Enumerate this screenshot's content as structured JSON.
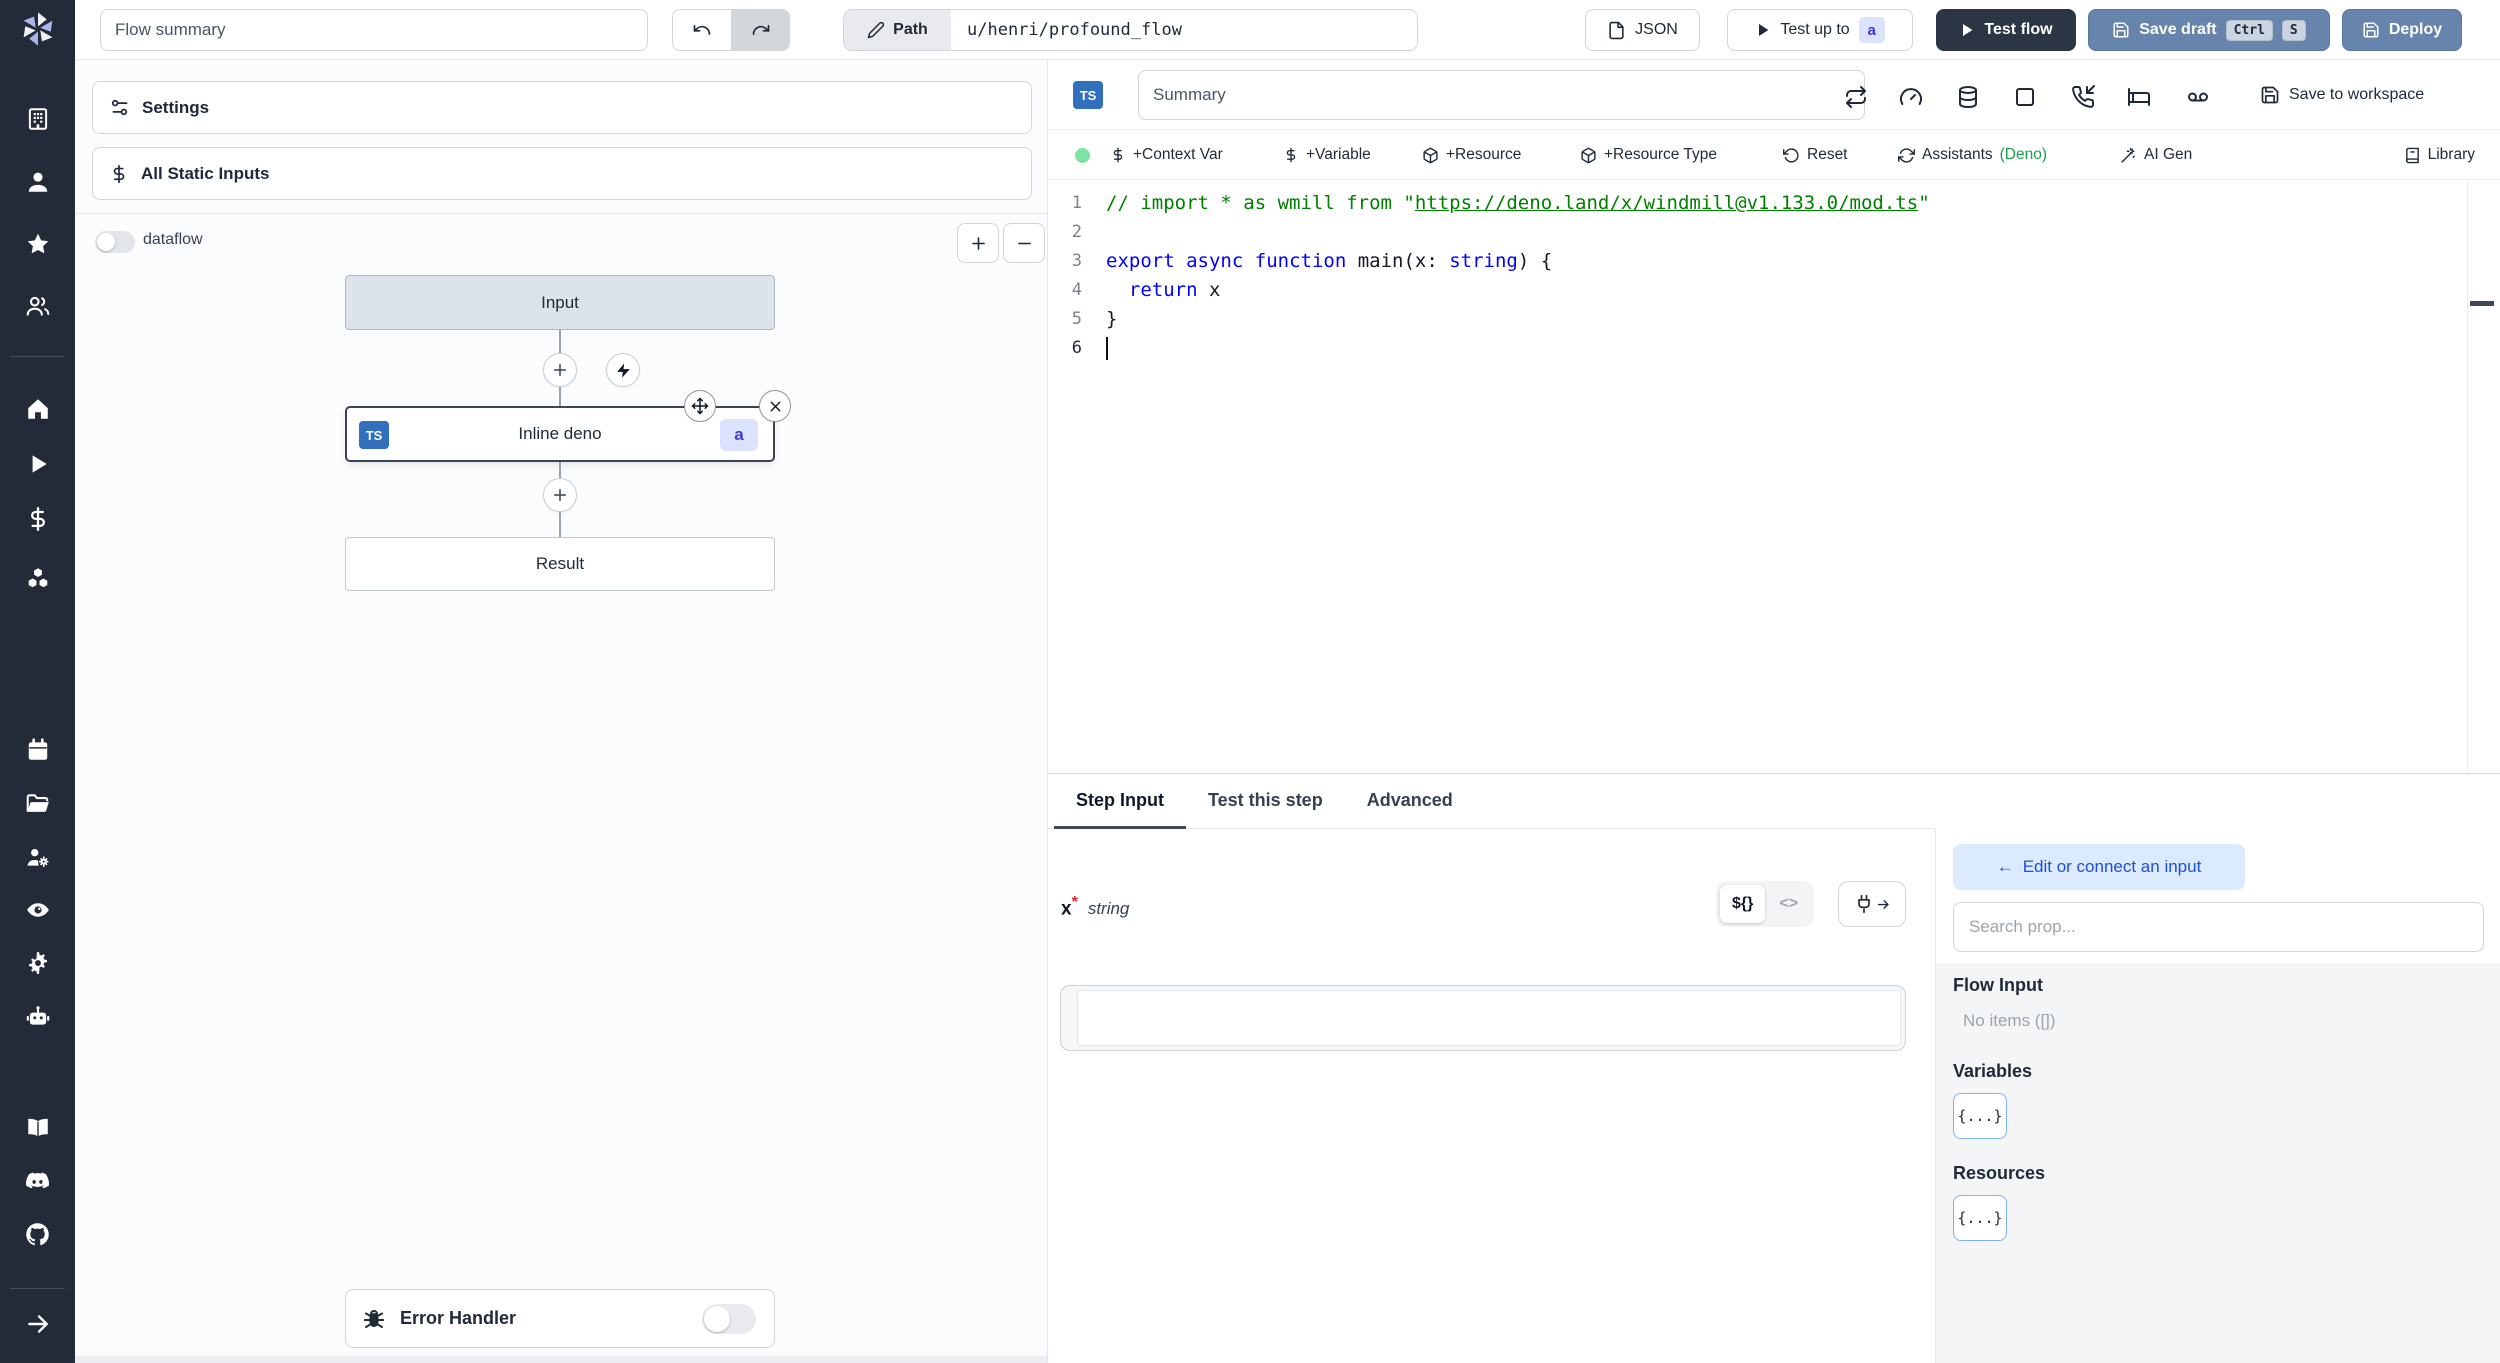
{
  "topbar": {
    "flow_summary_placeholder": "Flow summary",
    "path_label": "Path",
    "path_value": "u/henri/profound_flow",
    "json_label": "JSON",
    "test_up_to_label": "Test up to",
    "test_up_to_badge": "a",
    "test_flow_label": "Test flow",
    "save_draft_label": "Save draft",
    "kbd_ctrl": "Ctrl",
    "kbd_s": "S",
    "deploy_label": "Deploy"
  },
  "flow_panel": {
    "settings_label": "Settings",
    "all_static_inputs_label": "All Static Inputs",
    "dataflow_label": "dataflow",
    "input_node_label": "Input",
    "step_node": {
      "lang_badge": "TS",
      "label": "Inline deno",
      "id_badge": "a"
    },
    "result_node_label": "Result",
    "error_handler_label": "Error Handler"
  },
  "editor": {
    "lang_badge": "TS",
    "summary_placeholder": "Summary",
    "save_to_workspace_label": "Save to workspace",
    "toolbar": {
      "context_var": "+Context Var",
      "variable": "+Variable",
      "resource": "+Resource",
      "resource_type": "+Resource Type",
      "reset": "Reset",
      "assistants": "Assistants",
      "assistants_lang": "(Deno)",
      "ai_gen": "AI Gen",
      "library": "Library"
    },
    "code": {
      "language": "typescript",
      "lines": [
        {
          "n": 1,
          "segments": [
            {
              "c": "comment",
              "t": "// import * as wmill from \""
            },
            {
              "c": "comment link",
              "t": "https://deno.land/x/windmill@v1.133.0/mod.ts"
            },
            {
              "c": "comment",
              "t": "\""
            }
          ]
        },
        {
          "n": 2,
          "segments": []
        },
        {
          "n": 3,
          "segments": [
            {
              "c": "kw",
              "t": "export"
            },
            {
              "c": "plain",
              "t": " "
            },
            {
              "c": "kw",
              "t": "async"
            },
            {
              "c": "plain",
              "t": " "
            },
            {
              "c": "kw",
              "t": "function"
            },
            {
              "c": "plain",
              "t": " main(x: "
            },
            {
              "c": "kw",
              "t": "string"
            },
            {
              "c": "plain",
              "t": ") {"
            }
          ]
        },
        {
          "n": 4,
          "segments": [
            {
              "c": "plain",
              "t": "  "
            },
            {
              "c": "kw",
              "t": "return"
            },
            {
              "c": "plain",
              "t": " x"
            }
          ]
        },
        {
          "n": 5,
          "segments": [
            {
              "c": "plain",
              "t": "}"
            }
          ]
        },
        {
          "n": 6,
          "segments": [],
          "cursor": true
        }
      ]
    }
  },
  "step_panel": {
    "tabs": {
      "step_input": "Step Input",
      "test_this_step": "Test this step",
      "advanced": "Advanced"
    },
    "field": {
      "name": "x",
      "required_marker": "*",
      "type": "string",
      "value": ""
    },
    "editor_toggle": {
      "template": "${}",
      "code": "<>"
    },
    "prop_picker": {
      "back_arrow": "←",
      "edit_connect_label": "Edit or connect an input",
      "search_placeholder": "Search prop...",
      "flow_input_title": "Flow Input",
      "flow_input_empty": "No items ([])",
      "variables_title": "Variables",
      "variables_chip": "{...}",
      "resources_title": "Resources",
      "resources_chip": "{...}"
    }
  },
  "colors": {
    "rail_dark": "#232a38",
    "button_blue": "#6684ac",
    "button_dark": "#2b3543",
    "ts_badge_blue": "#3270bd",
    "badge_indigo_bg": "#dbe2fd",
    "badge_indigo_text": "#4338ca",
    "comment_green": "#008000",
    "keyword_blue": "#0000ff",
    "assistants_green": "#16a34a",
    "link_blue": "#1d4ed8",
    "status_dot_green": "#7ce3a3"
  }
}
